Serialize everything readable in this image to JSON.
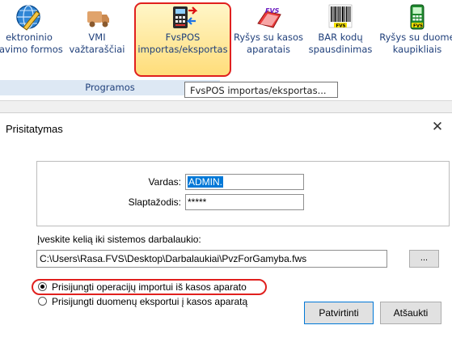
{
  "ribbon": {
    "items": [
      {
        "label1": "ektroninio",
        "label2": "ravimo formos",
        "icon": "globe-pencil-icon"
      },
      {
        "label1": "VMI",
        "label2": "važtaraščiai",
        "icon": "truck-icon"
      },
      {
        "label1": "FvsPOS",
        "label2": "importas/eksportas",
        "icon": "pos-terminal-icon"
      },
      {
        "label1": "Ryšys su kasos",
        "label2": "aparatais",
        "icon": "cash-register-icon"
      },
      {
        "label1": "BAR kodų",
        "label2": "spausdinimas",
        "icon": "barcode-icon"
      },
      {
        "label1": "Ryšys su duome",
        "label2": "kaupikliais",
        "icon": "data-collector-icon"
      }
    ],
    "group_label": "Programos",
    "tooltip": "FvsPOS importas/eksportas...",
    "icon_texts": {
      "fvs": "FVS",
      "bar_fvs": "FVS",
      "data_fvs": "FVS"
    },
    "highlight_color": "#e0201e"
  },
  "dialog": {
    "title": "Prisitatymas",
    "close_label": "✕",
    "username_label": "Vardas:",
    "username_value": "ADMIN.",
    "password_label": "Slaptažodis:",
    "password_value": "*****",
    "path_label": "Įveskite kelią iki sistemos darbalaukio:",
    "path_value": "C:\\Users\\Rasa.FVS\\Desktop\\Darbalaukiai\\PvzForGamyba.fws",
    "browse_label": "...",
    "radio_import_label": "Prisijungti operacijų importui iš kasos aparato",
    "radio_import_selected": true,
    "radio_export_label": "Prisijungti duomenų eksportui į kasos aparatą",
    "radio_export_selected": false,
    "confirm_label": "Patvirtinti",
    "cancel_label": "Atšaukti"
  }
}
